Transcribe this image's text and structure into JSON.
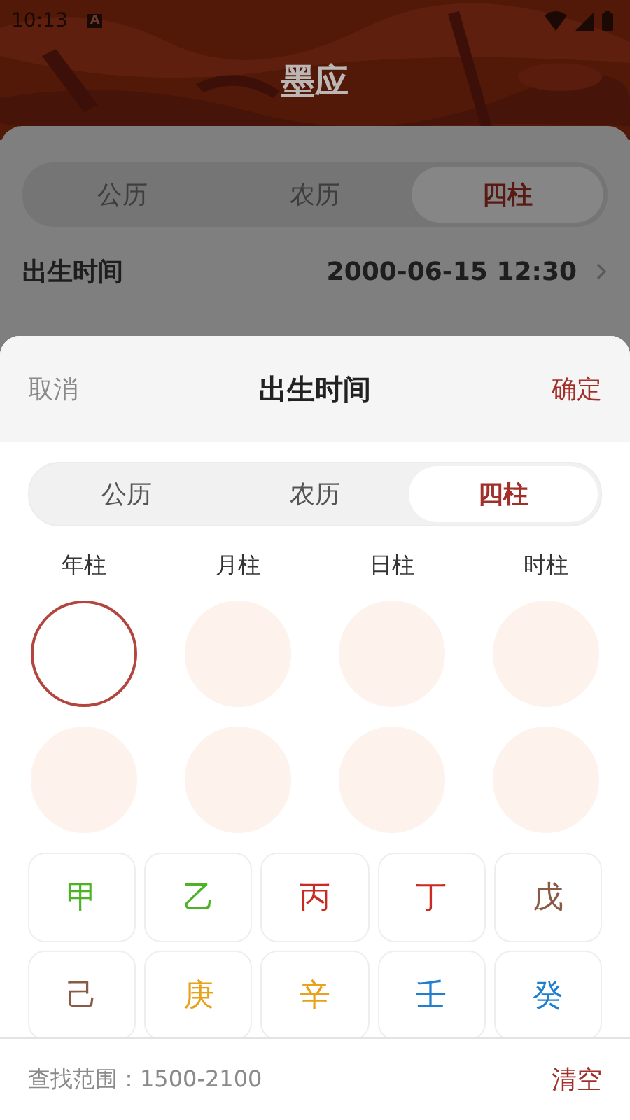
{
  "status_bar": {
    "time": "10:13",
    "notification": "A"
  },
  "app_bar": {
    "title": "墨应"
  },
  "background_sheet": {
    "tabs": [
      {
        "label": "公历",
        "selected": false
      },
      {
        "label": "农历",
        "selected": false
      },
      {
        "label": "四柱",
        "selected": true
      }
    ],
    "birth_time": {
      "label": "出生时间",
      "value": "2000-06-15 12:30"
    }
  },
  "picker": {
    "cancel": "取消",
    "title": "出生时间",
    "confirm": "确定",
    "tabs": [
      {
        "label": "公历",
        "selected": false
      },
      {
        "label": "农历",
        "selected": false
      },
      {
        "label": "四柱",
        "selected": true
      }
    ],
    "columns": [
      "年柱",
      "月柱",
      "日柱",
      "时柱"
    ],
    "slots": [
      [
        {
          "selected": true
        },
        {
          "selected": false
        },
        {
          "selected": false
        },
        {
          "selected": false
        }
      ],
      [
        {
          "selected": false
        },
        {
          "selected": false
        },
        {
          "selected": false
        },
        {
          "selected": false
        }
      ]
    ],
    "stems": [
      {
        "label": "甲",
        "color": "#4bb324"
      },
      {
        "label": "乙",
        "color": "#4bb324"
      },
      {
        "label": "丙",
        "color": "#c92a22"
      },
      {
        "label": "丁",
        "color": "#c92a22"
      },
      {
        "label": "戊",
        "color": "#8a5a44"
      },
      {
        "label": "己",
        "color": "#8a5a44"
      },
      {
        "label": "庚",
        "color": "#e8a118"
      },
      {
        "label": "辛",
        "color": "#e8a118"
      },
      {
        "label": "壬",
        "color": "#1e7fd0"
      },
      {
        "label": "癸",
        "color": "#1e7fd0"
      }
    ],
    "footer": {
      "range": "查找范围：1500-2100",
      "clear": "清空"
    }
  }
}
